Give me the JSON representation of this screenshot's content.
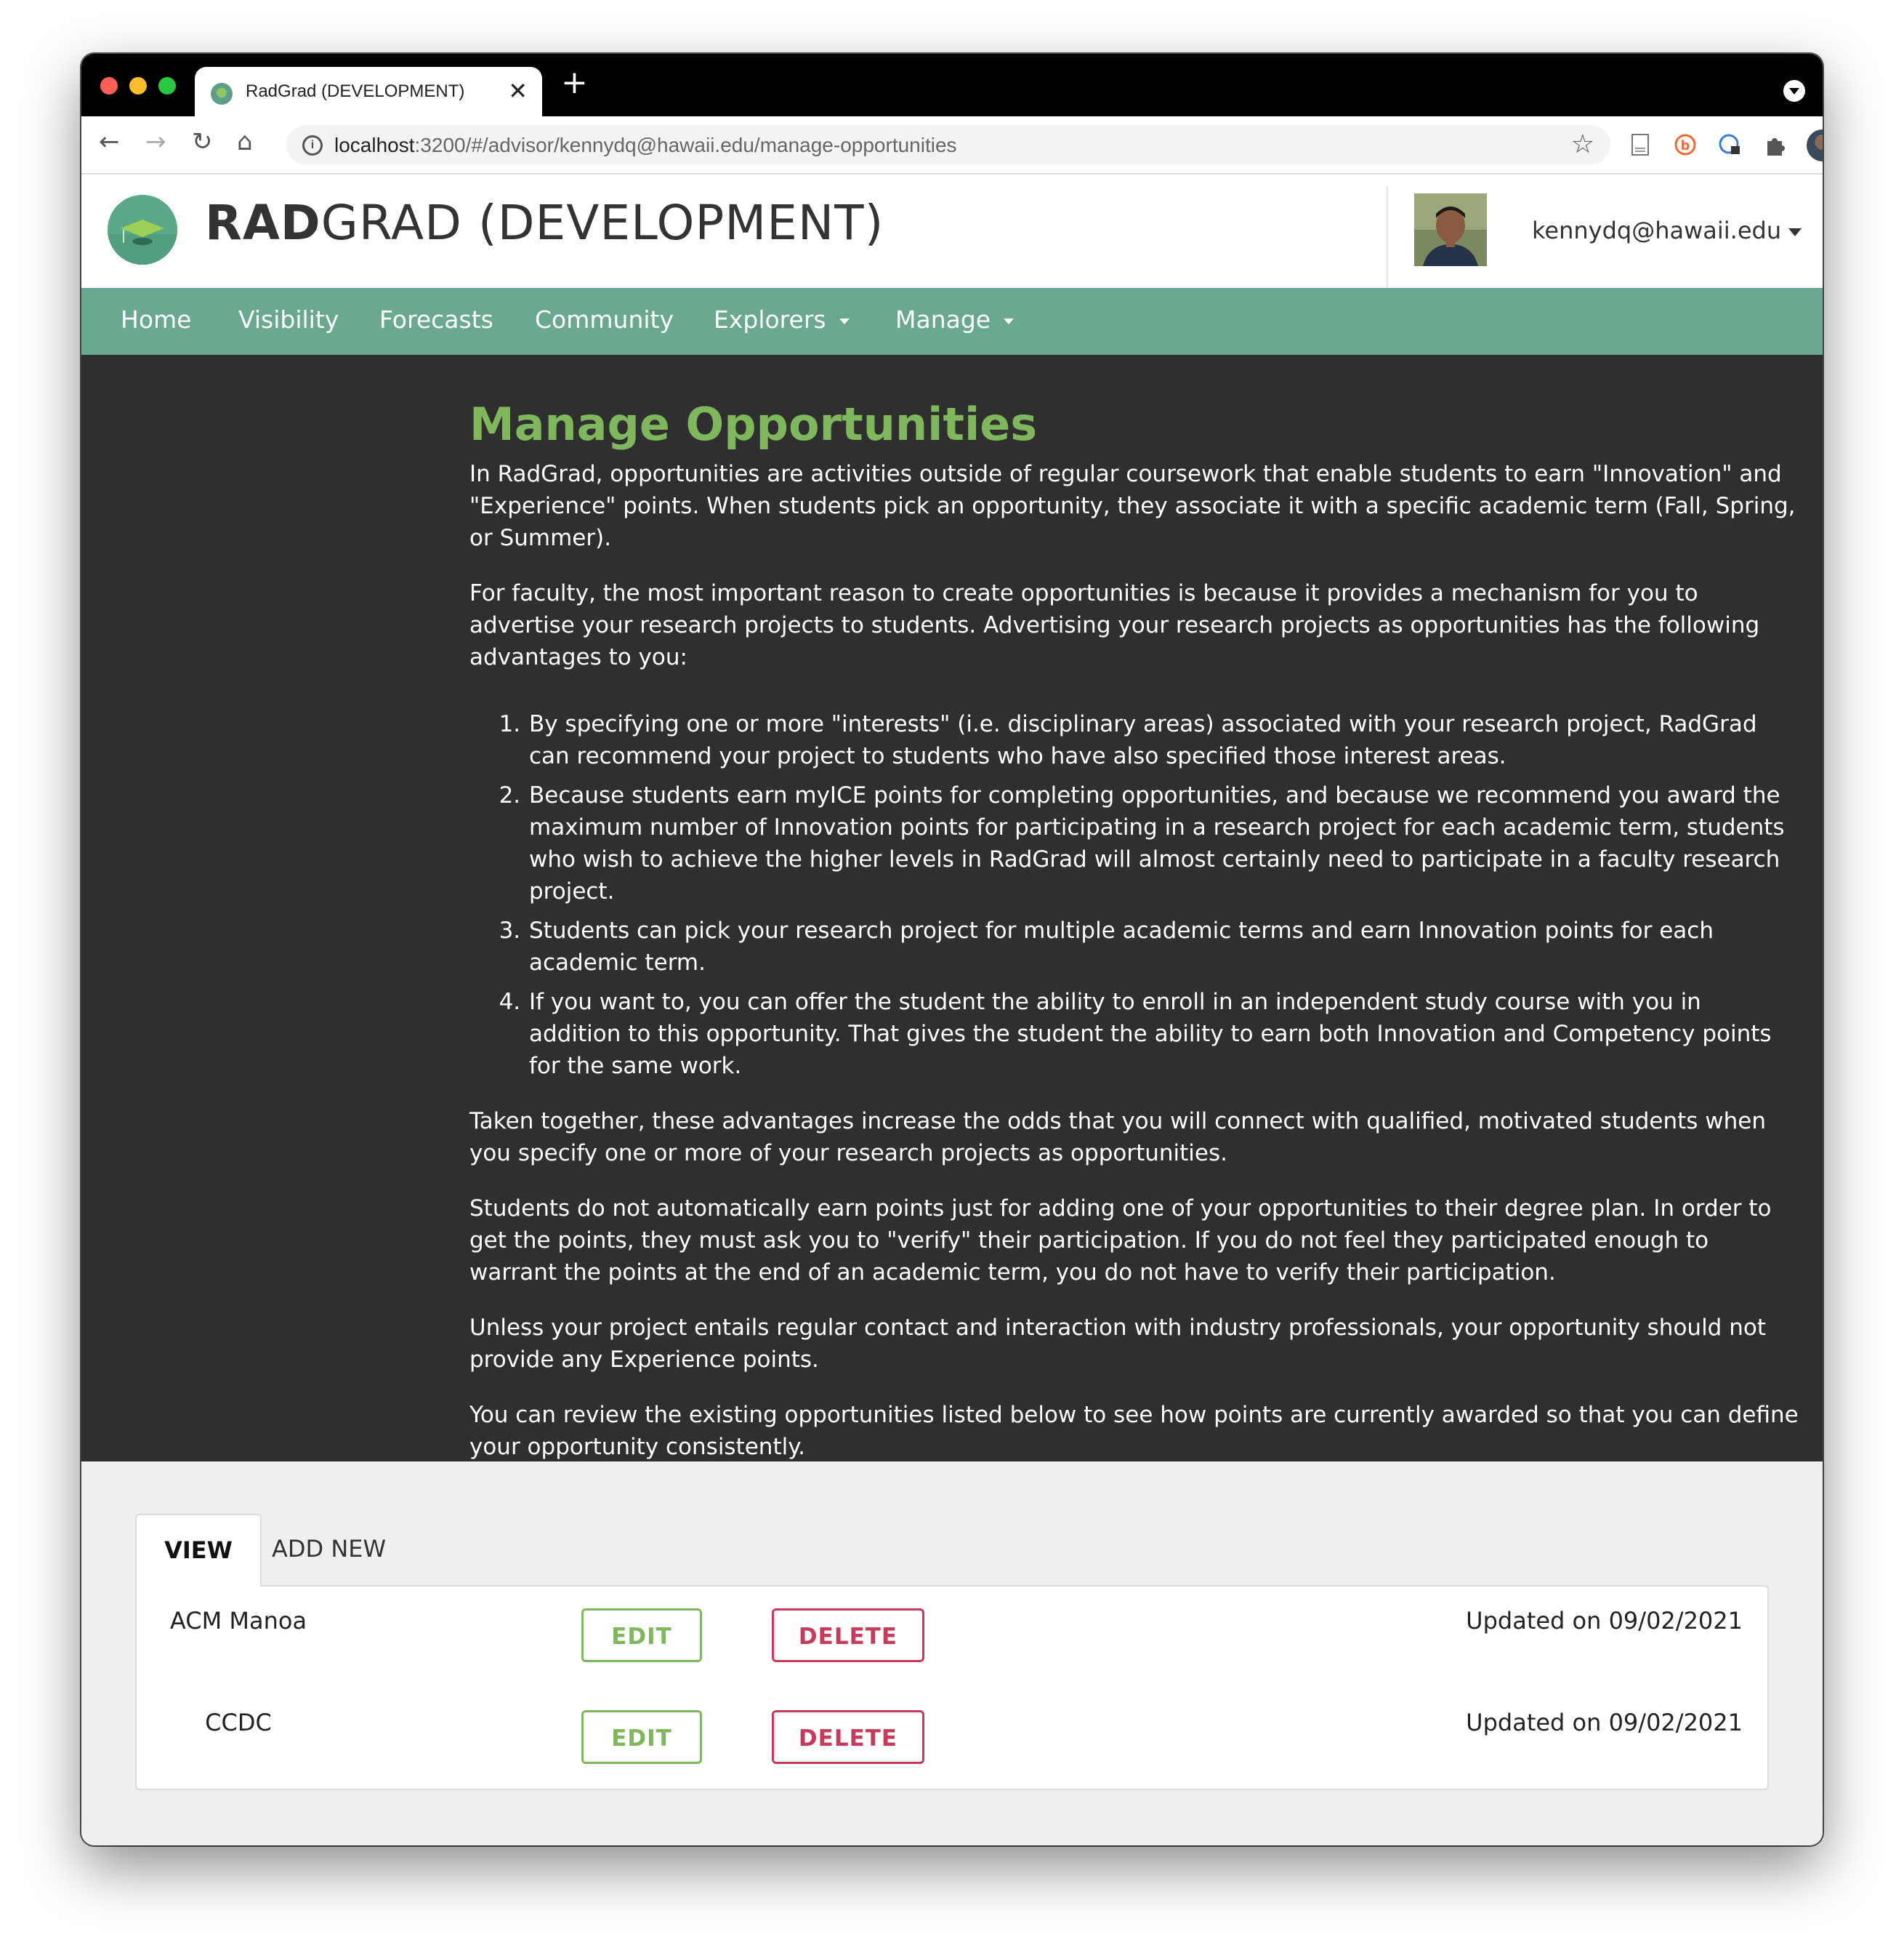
{
  "browser": {
    "tab_title": "RadGrad (DEVELOPMENT)",
    "url_host": "localhost",
    "url_rest": ":3200/#/advisor/kennydq@hawaii.edu/manage-opportunities"
  },
  "header": {
    "brand_bold": "RAD",
    "brand_rest": "GRAD (DEVELOPMENT)",
    "user_email": "kennydq@hawaii.edu"
  },
  "nav": {
    "items": [
      "Home",
      "Visibility",
      "Forecasts",
      "Community",
      "Explorers",
      "Manage"
    ]
  },
  "main": {
    "title": "Manage Opportunities",
    "intro_1": "In RadGrad, opportunities are activities outside of regular coursework that enable students to earn \"Innovation\" and \"Experience\" points. When students pick an opportunity, they associate it with a specific academic term (Fall, Spring, or Summer).",
    "intro_2": "For faculty, the most important reason to create opportunities is because it provides a mechanism for you to advertise your research projects to students. Advertising your research projects as opportunities has the following advantages to you:",
    "advantages": [
      "By specifying one or more \"interests\" (i.e. disciplinary areas) associated with your research project, RadGrad can recommend your project to students who have also specified those interest areas.",
      "Because students earn myICE points for completing opportunities, and because we recommend you award the maximum number of Innovation points for participating in a research project for each academic term, students who wish to achieve the higher levels in RadGrad will almost certainly need to participate in a faculty research project.",
      "Students can pick your research project for multiple academic terms and earn Innovation points for each academic term.",
      "If you want to, you can offer the student the ability to enroll in an independent study course with you in addition to this opportunity. That gives the student the ability to earn both Innovation and Competency points for the same work."
    ],
    "para_3": "Taken together, these advantages increase the odds that you will connect with qualified, motivated students when you specify one or more of your research projects as opportunities.",
    "para_4": "Students do not automatically earn points just for adding one of your opportunities to their degree plan. In order to get the points, they must ask you to \"verify\" their participation. If you do not feel they participated enough to warrant the points at the end of an academic term, you do not have to verify their participation.",
    "para_5": "Unless your project entails regular contact and interaction with industry professionals, your opportunity should not provide any Experience points.",
    "para_6": "You can review the existing opportunities listed below to see how points are currently awarded so that you can define your opportunity consistently."
  },
  "tabs": {
    "view_label": "VIEW",
    "add_label": "ADD NEW"
  },
  "opportunities": [
    {
      "name": "ACM Manoa",
      "edit_label": "EDIT",
      "delete_label": "DELETE",
      "updated": "Updated on 09/02/2021"
    },
    {
      "name": "CCDC",
      "edit_label": "EDIT",
      "delete_label": "DELETE",
      "updated": "Updated on 09/02/2021"
    }
  ],
  "colors": {
    "nav_bg": "#6aa890",
    "title_green": "#7fb85c",
    "delete_red": "#c63a5a",
    "dark_bg": "#2f2f2f"
  }
}
